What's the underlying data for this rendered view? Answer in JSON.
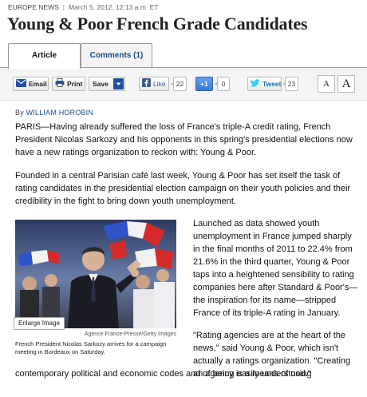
{
  "meta": {
    "section": "Europe News",
    "separator": "|",
    "dateline": "March 5, 2012, 12:13 a.m. ET"
  },
  "headline": "Young & Poor French Grade Candidates",
  "tabs": [
    {
      "label": "Article"
    },
    {
      "label": "Comments (1)"
    }
  ],
  "toolbar": {
    "email_label": "Email",
    "print_label": "Print",
    "save_label": "Save",
    "like_label": "Like",
    "like_count": "22",
    "plusone_label": "+1",
    "plusone_count": "0",
    "tweet_label": "Tweet",
    "tweet_count": "23",
    "font_small": "A",
    "font_large": "A"
  },
  "byline": {
    "prefix": "By",
    "author": "WILLIAM HOROBIN"
  },
  "body": {
    "p1": "PARIS—Having already suffered the loss of France's triple-A credit rating, French President Nicolas Sarkozy and his opponents in this spring's presidential elections now have a new ratings organization to reckon with: Young & Poor.",
    "p2": "Founded in a central Parisian café last week, Young & Poor has set itself the task of rating candidates in the presidential election campaign on their youth policies and their credibility in the fight to bring down youth unemployment.",
    "p3": "Launched as data showed youth unemployment in France jumped sharply in the final months of 2011 to 22.4% from 21.6% in the third quarter, Young & Poor taps into a heightened sensibility to rating companies here after Standard & Poor's—the inspiration for its name—stripped France of its triple-A rating in January.",
    "p4a": "\"Rating agencies are at the heart of the news,\" said Young & Poor, which isn't actually a ratings organization. \"Creating an agency is a means of using",
    "p4b": "contemporary political and economic codes and of being easily understood.\""
  },
  "photo": {
    "enlarge_label": "Enlarge Image",
    "credit": "Agence France-Presse/Getty Images",
    "caption": "French President Nicolas Sarkozy arrives for a campaign meeting in Bordeaux on Saturday."
  },
  "colors": {
    "link": "#1a4a8c",
    "facebook": "#3b5998",
    "google": "#3a7bd5",
    "twitter": "#33ccff"
  }
}
